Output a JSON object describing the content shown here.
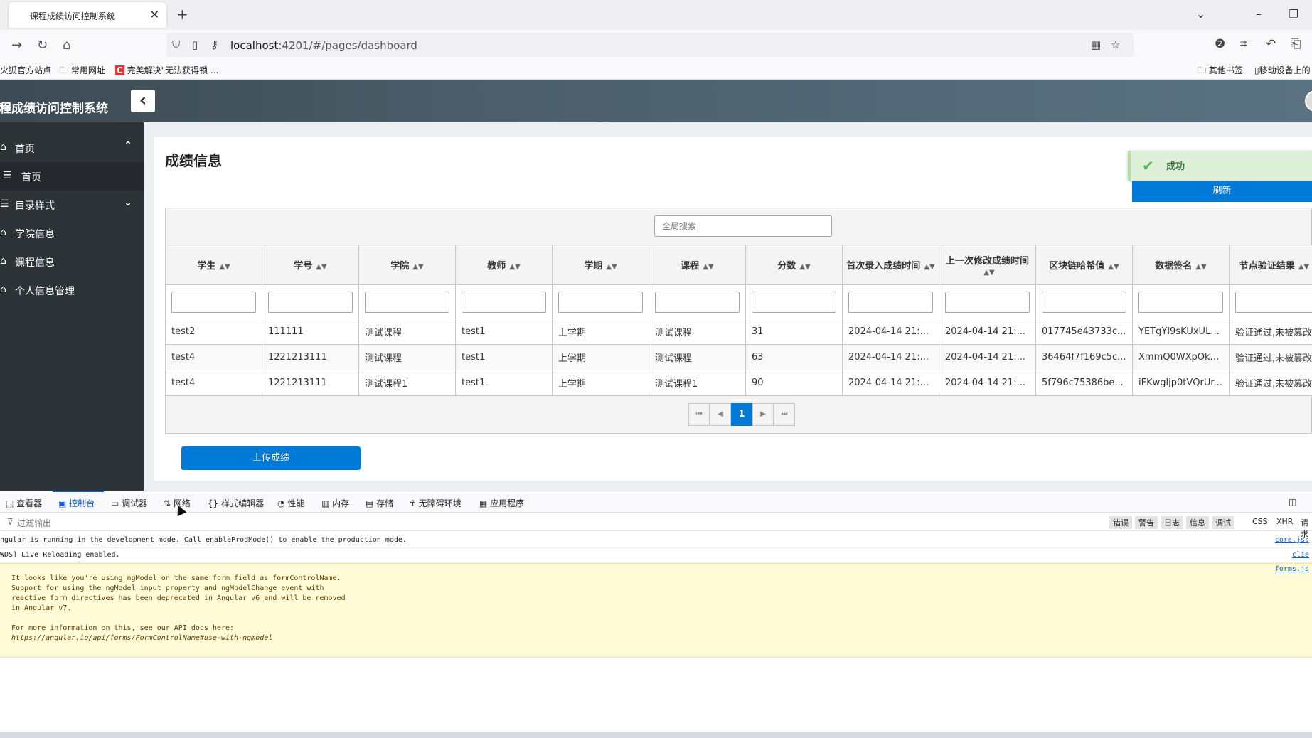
{
  "browser": {
    "tab_title": "课程成绩访问控制系统",
    "tab_close": "✕",
    "new_tab": "+",
    "url_host": "localhost",
    "url_rest": ":4201/#/pages/dashboard",
    "bookmarks": [
      "火狐官方站点",
      "常用网址",
      "完美解决\"无法获得锁 ..."
    ],
    "bookmarks_right": [
      "其他书签",
      "移动设备上的"
    ]
  },
  "app": {
    "title": "课程成绩访问控制系统"
  },
  "sidebar": {
    "items": [
      {
        "icon": "home-icon",
        "glyph": "⌂",
        "label": "首页",
        "chevron": "⌃"
      },
      {
        "icon": "list-icon",
        "glyph": "☰",
        "label": "首页"
      },
      {
        "icon": "list-icon",
        "glyph": "☰",
        "label": "目录样式",
        "chevron": "⌄"
      },
      {
        "icon": "home-icon",
        "glyph": "⌂",
        "label": "学院信息"
      },
      {
        "icon": "home-icon",
        "glyph": "⌂",
        "label": "课程信息"
      },
      {
        "icon": "home-icon",
        "glyph": "⌂",
        "label": "个人信息管理"
      }
    ]
  },
  "main": {
    "page_title": "成绩信息",
    "toast": {
      "text": "成功",
      "icon": "check-icon"
    },
    "refresh_label": "刷新",
    "search_placeholder": "全局搜索",
    "upload_label": "上传成绩"
  },
  "table": {
    "columns": [
      "学生",
      "学号",
      "学院",
      "教师",
      "学期",
      "课程",
      "分数",
      "首次录入成绩时间",
      "上一次修改成绩时间",
      "区块链哈希值",
      "数据签名",
      "节点验证结果"
    ],
    "rows": [
      [
        "test2",
        "111111",
        "测试课程",
        "test1",
        "上学期",
        "测试课程",
        "31",
        "2024-04-14 21:...",
        "2024-04-14 21:...",
        "017745e43733c...",
        "YETgYI9sKUxUL...",
        "验证通过,未被篡改"
      ],
      [
        "test4",
        "1221213111",
        "测试课程",
        "test1",
        "上学期",
        "测试课程",
        "63",
        "2024-04-14 21:...",
        "2024-04-14 21:...",
        "36464f7f169c5c...",
        "XmmQ0WXpOk+...",
        "验证通过,未被篡改"
      ],
      [
        "test4",
        "1221213111",
        "测试课程1",
        "test1",
        "上学期",
        "测试课程1",
        "90",
        "2024-04-14 21:...",
        "2024-04-14 21:...",
        "5f796c75386be...",
        "iFKwgljp0tVQrUr...",
        "验证通过,未被篡改"
      ]
    ],
    "pager": {
      "current_page": "1"
    }
  },
  "devtools": {
    "tabs": [
      "查看器",
      "控制台",
      "调试器",
      "网络",
      "样式编辑器",
      "性能",
      "内存",
      "存储",
      "无障碍环境",
      "应用程序"
    ],
    "active_tab": "控制台",
    "filter_placeholder": "过滤输出",
    "levels": [
      "错误",
      "警告",
      "日志",
      "信息",
      "调试"
    ],
    "types": [
      "CSS",
      "XHR",
      "请求"
    ],
    "logs": [
      {
        "text": "ngular is running in the development mode. Call enableProdMode() to enable the production mode.",
        "source": "core.js:"
      },
      {
        "text": "WDS] Live Reloading enabled.",
        "source": "clie"
      }
    ],
    "warning": {
      "source": "forms.js",
      "lines": [
        "It looks like you're using ngModel on the same form field as formControlName.",
        "Support for using the ngModel input property and ngModelChange event with",
        "reactive form directives has been deprecated in Angular v6 and will be removed",
        "in Angular v7.",
        "",
        "For more information on this, see our API docs here:"
      ],
      "link": "https://angular.io/api/forms/FormControlName#use-with-ngmodel"
    }
  },
  "colors": {
    "primary": "#007ad9",
    "sidebar_bg": "#2e3338",
    "toast_bg": "#dff0d8",
    "warning_bg": "#fffbd6"
  }
}
